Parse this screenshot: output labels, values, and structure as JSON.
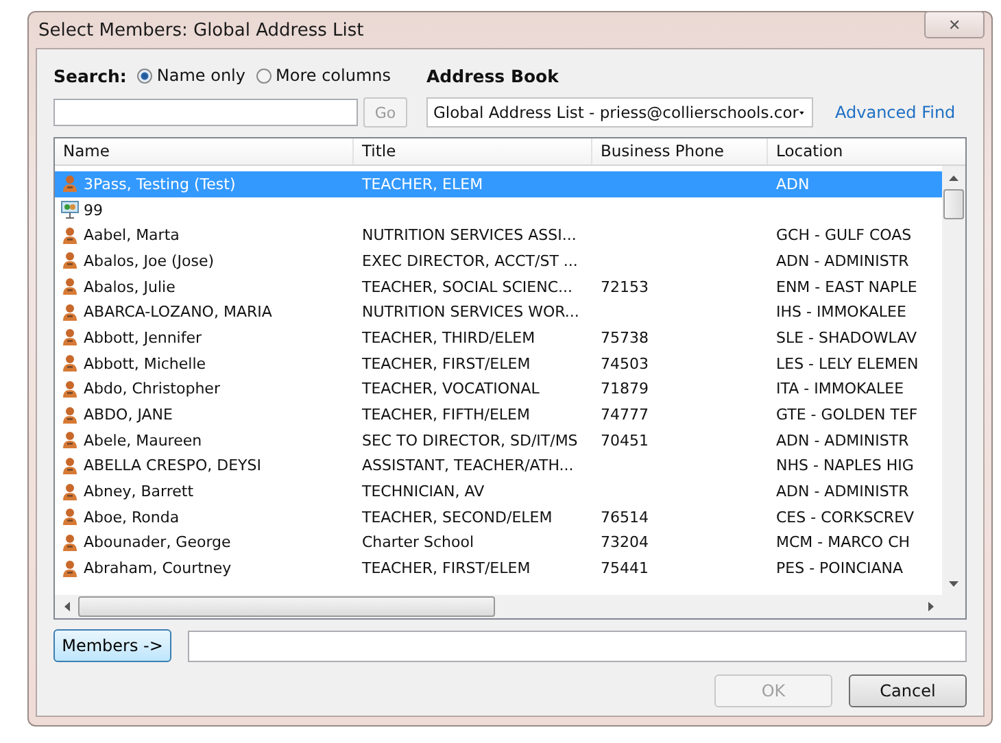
{
  "window": {
    "title": "Select Members: Global Address List",
    "close": "✕"
  },
  "search": {
    "label": "Search:",
    "options": [
      {
        "label": "Name only",
        "selected": true
      },
      {
        "label": "More columns",
        "selected": false
      }
    ],
    "go": "Go",
    "go_disabled": true
  },
  "address_book": {
    "label": "Address Book",
    "value": "Global Address List - priess@collierschools.cor",
    "advanced_find": "Advanced Find"
  },
  "table": {
    "columns": [
      "Name",
      "Title",
      "Business Phone",
      "Location"
    ],
    "rows": [
      {
        "kind": "person",
        "name": "3Pass, Testing  (Test)",
        "title": "TEACHER, ELEM",
        "phone": "",
        "location": "ADN",
        "selected": true
      },
      {
        "kind": "group",
        "name": "99",
        "title": "",
        "phone": "",
        "location": "",
        "selected": false
      },
      {
        "kind": "person",
        "name": "Aabel, Marta",
        "title": "NUTRITION SERVICES ASSI...",
        "phone": "",
        "location": "GCH - GULF COAS",
        "selected": false
      },
      {
        "kind": "person",
        "name": "Abalos, Joe  (Jose)",
        "title": "EXEC DIRECTOR, ACCT/ST ...",
        "phone": "",
        "location": "ADN - ADMINISTR",
        "selected": false
      },
      {
        "kind": "person",
        "name": "Abalos, Julie",
        "title": "TEACHER, SOCIAL SCIENC...",
        "phone": "72153",
        "location": "ENM - EAST NAPLE",
        "selected": false
      },
      {
        "kind": "person",
        "name": "ABARCA-LOZANO, MARIA",
        "title": "NUTRITION SERVICES WOR...",
        "phone": "",
        "location": "IHS - IMMOKALEE",
        "selected": false
      },
      {
        "kind": "person",
        "name": "Abbott, Jennifer",
        "title": "TEACHER, THIRD/ELEM",
        "phone": "75738",
        "location": "SLE - SHADOWLAV",
        "selected": false
      },
      {
        "kind": "person",
        "name": "Abbott, Michelle",
        "title": "TEACHER, FIRST/ELEM",
        "phone": "74503",
        "location": "LES - LELY ELEMEN",
        "selected": false
      },
      {
        "kind": "person",
        "name": "Abdo, Christopher",
        "title": "TEACHER, VOCATIONAL",
        "phone": "71879",
        "location": "ITA - IMMOKALEE",
        "selected": false
      },
      {
        "kind": "person",
        "name": "ABDO, JANE",
        "title": "TEACHER, FIFTH/ELEM",
        "phone": "74777",
        "location": "GTE - GOLDEN TEF",
        "selected": false
      },
      {
        "kind": "person",
        "name": "Abele, Maureen",
        "title": "SEC TO DIRECTOR, SD/IT/MS",
        "phone": "70451",
        "location": "ADN - ADMINISTR",
        "selected": false
      },
      {
        "kind": "person",
        "name": "ABELLA CRESPO, DEYSI",
        "title": "ASSISTANT, TEACHER/ATH...",
        "phone": "",
        "location": "NHS - NAPLES HIG",
        "selected": false
      },
      {
        "kind": "person",
        "name": "Abney, Barrett",
        "title": "TECHNICIAN, AV",
        "phone": "",
        "location": "ADN - ADMINISTR",
        "selected": false
      },
      {
        "kind": "person",
        "name": "Aboe, Ronda",
        "title": "TEACHER, SECOND/ELEM",
        "phone": "76514",
        "location": "CES - CORKSCREV",
        "selected": false
      },
      {
        "kind": "person",
        "name": "Abounader, George",
        "title": "Charter School",
        "phone": "73204",
        "location": "MCM - MARCO CH",
        "selected": false
      },
      {
        "kind": "person",
        "name": "Abraham, Courtney",
        "title": "TEACHER, FIRST/ELEM",
        "phone": "75441",
        "location": "PES - POINCIANA",
        "selected": false
      }
    ]
  },
  "members": {
    "button": "Members ->"
  },
  "buttons": [
    {
      "label": "OK",
      "disabled": true
    },
    {
      "label": "Cancel",
      "disabled": false
    }
  ]
}
